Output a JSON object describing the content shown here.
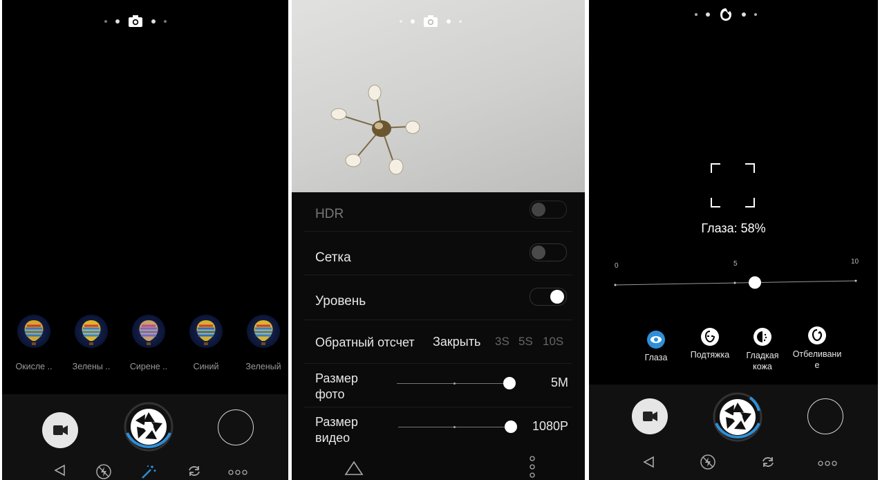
{
  "left_panel": {
    "filters": [
      {
        "label": "Окисле .."
      },
      {
        "label": "Зелены .."
      },
      {
        "label": "Сирене .."
      },
      {
        "label": "Синий"
      },
      {
        "label": "Зеленый"
      }
    ],
    "indicator_icon": "camera-icon"
  },
  "middle_panel": {
    "indicator_icon": "camera-icon",
    "settings": {
      "hdr": {
        "label": "HDR",
        "enabled": false
      },
      "grid": {
        "label": "Сетка",
        "enabled": false
      },
      "level": {
        "label": "Уровень",
        "enabled": true
      },
      "countdown": {
        "label": "Обратный отсчет",
        "options": [
          "Закрыть",
          "3S",
          "5S",
          "10S"
        ],
        "selected": "Закрыть"
      },
      "photo_size": {
        "label_line1": "Размер",
        "label_line2": "фото",
        "value": "5M"
      },
      "video_size": {
        "label_line1": "Размер",
        "label_line2": "видео",
        "value": "1080P"
      }
    }
  },
  "right_panel": {
    "indicator_icon": "beauty-icon",
    "status": "Глаза: 58%",
    "slider": {
      "min_label": "0",
      "mid_label": "5",
      "max_label": "10",
      "value": 5.8
    },
    "options": [
      {
        "label_line1": "Глаза",
        "label_line2": "",
        "icon": "eye-icon",
        "active": true
      },
      {
        "label_line1": "Подтяжка",
        "label_line2": "",
        "icon": "face-slim-icon",
        "active": false
      },
      {
        "label_line1": "Гладкая",
        "label_line2": "кожа",
        "icon": "smooth-skin-icon",
        "active": false
      },
      {
        "label_line1": "Отбеливани",
        "label_line2": "е",
        "icon": "whitening-icon",
        "active": false
      }
    ]
  },
  "colors": {
    "accent": "#2e8fd8",
    "background": "#000000",
    "text": "#e8e8e8",
    "muted": "#9a9a9a"
  }
}
